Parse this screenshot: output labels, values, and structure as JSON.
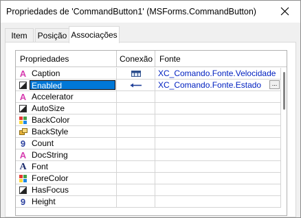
{
  "window": {
    "title": "Propriedades de 'CommandButton1' (MSForms.CommandButton)",
    "close_glyph": "✕"
  },
  "tabs": [
    {
      "label": "Item",
      "active": false
    },
    {
      "label": "Posição",
      "active": false
    },
    {
      "label": "Associações",
      "active": true
    }
  ],
  "grid": {
    "headers": {
      "property": "Propriedades",
      "connection": "Conexão",
      "source": "Fonte"
    },
    "selected_row": 1,
    "rows": [
      {
        "icon": "text-a-icon",
        "name": "Caption",
        "connection": "table-connection-icon",
        "source": "XC_Comando.Fonte.Velocidade"
      },
      {
        "icon": "boolean-icon",
        "name": "Enabled",
        "connection": "left-arrow-icon",
        "source": "XC_Comando.Fonte.Estado"
      },
      {
        "icon": "text-a-icon",
        "name": "Accelerator",
        "connection": "",
        "source": ""
      },
      {
        "icon": "boolean-icon",
        "name": "AutoSize",
        "connection": "",
        "source": ""
      },
      {
        "icon": "color-icon",
        "name": "BackColor",
        "connection": "",
        "source": ""
      },
      {
        "icon": "style-icon",
        "name": "BackStyle",
        "connection": "",
        "source": ""
      },
      {
        "icon": "number-icon",
        "name": "Count",
        "connection": "",
        "source": ""
      },
      {
        "icon": "text-a-icon",
        "name": "DocString",
        "connection": "",
        "source": ""
      },
      {
        "icon": "font-icon",
        "name": "Font",
        "connection": "",
        "source": ""
      },
      {
        "icon": "color-icon",
        "name": "ForeColor",
        "connection": "",
        "source": ""
      },
      {
        "icon": "boolean-icon",
        "name": "HasFocus",
        "connection": "",
        "source": ""
      },
      {
        "icon": "number-icon",
        "name": "Height",
        "connection": "",
        "source": ""
      }
    ],
    "ellipsis_label": "..."
  },
  "colors": {
    "selection": "#0078d7",
    "link_text": "#0020c0",
    "text_icon": "#d63cb0"
  }
}
